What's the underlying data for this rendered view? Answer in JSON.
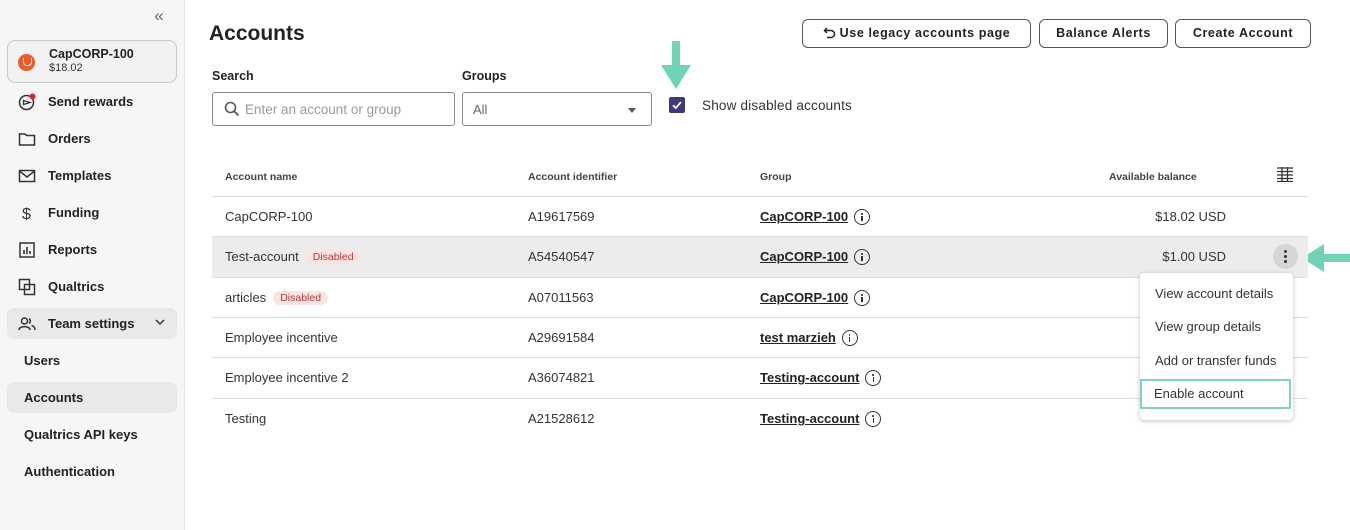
{
  "sidebar": {
    "org": {
      "name": "CapCORP-100",
      "balance": "$18.02"
    },
    "items": [
      {
        "label": "Send rewards",
        "icon": "send-rewards-icon"
      },
      {
        "label": "Orders",
        "icon": "folder-icon"
      },
      {
        "label": "Templates",
        "icon": "mail-icon"
      },
      {
        "label": "Funding",
        "icon": "dollar-icon"
      },
      {
        "label": "Reports",
        "icon": "bar-chart-icon"
      },
      {
        "label": "Qualtrics",
        "icon": "qualtrics-icon"
      },
      {
        "label": "Team settings",
        "icon": "team-icon"
      },
      {
        "label": "Users"
      },
      {
        "label": "Accounts"
      },
      {
        "label": "Qualtrics API keys"
      },
      {
        "label": "Authentication"
      }
    ]
  },
  "header": {
    "title": "Accounts",
    "legacy_btn": "Use legacy accounts page",
    "alerts_btn": "Balance Alerts",
    "create_btn": "Create Account"
  },
  "filters": {
    "search_label": "Search",
    "search_placeholder": "Enter an account or group",
    "groups_label": "Groups",
    "groups_value": "All",
    "show_disabled_label": "Show disabled accounts",
    "show_disabled_checked": true
  },
  "table": {
    "columns": [
      "Account name",
      "Account identifier",
      "Group",
      "Available balance"
    ],
    "rows": [
      {
        "name": "CapCORP-100",
        "badge": "",
        "id": "A19617569",
        "group": "CapCORP-100",
        "balance": "$18.02 USD"
      },
      {
        "name": "Test-account",
        "badge": "Disabled",
        "id": "A54540547",
        "group": "CapCORP-100",
        "balance": "$1.00 USD"
      },
      {
        "name": "articles",
        "badge": "Disabled",
        "id": "A07011563",
        "group": "CapCORP-100",
        "balance": ""
      },
      {
        "name": "Employee incentive",
        "badge": "",
        "id": "A29691584",
        "group": "test marzieh",
        "balance": ""
      },
      {
        "name": "Employee incentive 2",
        "badge": "",
        "id": "A36074821",
        "group": "Testing-account",
        "balance": ""
      },
      {
        "name": "Testing",
        "badge": "",
        "id": "A21528612",
        "group": "Testing-account",
        "balance": ""
      }
    ]
  },
  "row_menu": {
    "items": [
      "View account details",
      "View group details",
      "Add or transfer funds",
      "Enable account"
    ]
  },
  "colors": {
    "annotation_arrow": "#6fd3b6",
    "checkbox": "#3e3a80",
    "brand": "#f05a28",
    "disabled_badge_bg": "#fbe3e3",
    "disabled_badge_text": "#b43a3a"
  }
}
